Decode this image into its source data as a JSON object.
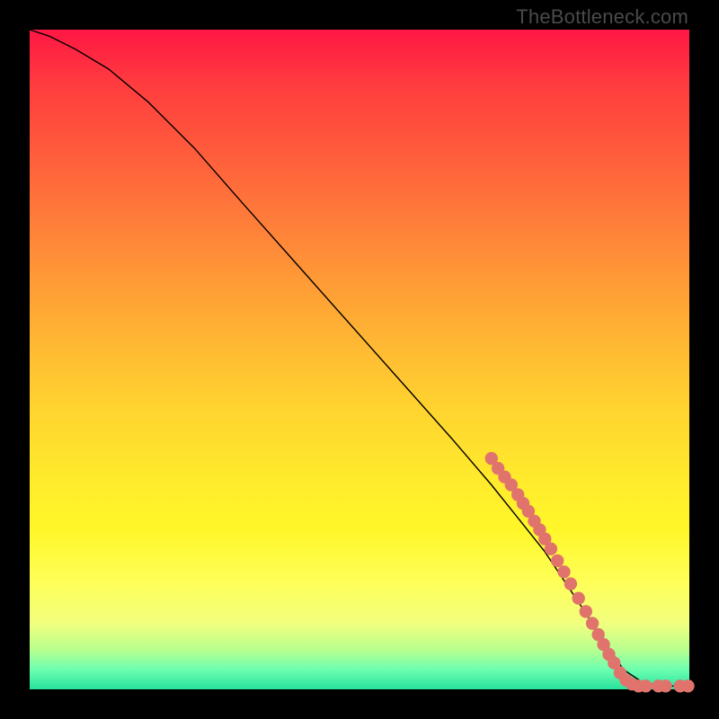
{
  "watermark": "TheBottleneck.com",
  "colors": {
    "marker": "#e0746c",
    "line": "#000000",
    "frame": "#000000"
  },
  "chart_data": {
    "type": "line",
    "title": "",
    "xlabel": "",
    "ylabel": "",
    "xlim": [
      0,
      100
    ],
    "ylim": [
      0,
      100
    ],
    "grid": false,
    "legend": false,
    "series": [
      {
        "name": "curve",
        "x": [
          0,
          3,
          7,
          12,
          18,
          25,
          32,
          40,
          48,
          56,
          64,
          70,
          74,
          78,
          82,
          86,
          88,
          90,
          93,
          96,
          100
        ],
        "y": [
          100,
          99,
          97,
          94,
          89,
          82,
          74,
          65,
          56,
          47,
          38,
          31,
          26,
          21,
          15,
          9,
          6,
          3,
          1,
          0.5,
          0.5
        ]
      }
    ],
    "markers": [
      {
        "x": 70.0,
        "y": 35.0
      },
      {
        "x": 71.0,
        "y": 33.5
      },
      {
        "x": 72.0,
        "y": 32.2
      },
      {
        "x": 73.0,
        "y": 31.0
      },
      {
        "x": 74.0,
        "y": 29.5
      },
      {
        "x": 74.8,
        "y": 28.2
      },
      {
        "x": 75.6,
        "y": 27.0
      },
      {
        "x": 76.5,
        "y": 25.5
      },
      {
        "x": 77.3,
        "y": 24.2
      },
      {
        "x": 78.1,
        "y": 22.8
      },
      {
        "x": 79.0,
        "y": 21.3
      },
      {
        "x": 80.0,
        "y": 19.5
      },
      {
        "x": 81.0,
        "y": 17.8
      },
      {
        "x": 82.0,
        "y": 16.0
      },
      {
        "x": 83.2,
        "y": 13.8
      },
      {
        "x": 84.3,
        "y": 11.8
      },
      {
        "x": 85.3,
        "y": 10.0
      },
      {
        "x": 86.2,
        "y": 8.3
      },
      {
        "x": 87.0,
        "y": 6.8
      },
      {
        "x": 87.8,
        "y": 5.3
      },
      {
        "x": 88.6,
        "y": 4.0
      },
      {
        "x": 89.5,
        "y": 2.5
      },
      {
        "x": 90.4,
        "y": 1.4
      },
      {
        "x": 91.3,
        "y": 0.8
      },
      {
        "x": 92.3,
        "y": 0.5
      },
      {
        "x": 93.4,
        "y": 0.5
      },
      {
        "x": 95.3,
        "y": 0.5
      },
      {
        "x": 96.4,
        "y": 0.5
      },
      {
        "x": 98.6,
        "y": 0.5
      },
      {
        "x": 99.8,
        "y": 0.5
      }
    ]
  }
}
